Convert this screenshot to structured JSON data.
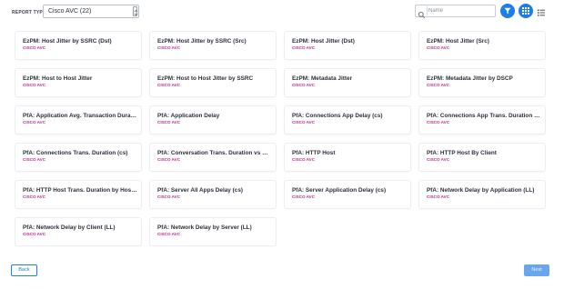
{
  "header": {
    "report_type_label": "REPORT TYPE:",
    "report_type_value": "Cisco AVC (22)",
    "search_placeholder": "Name"
  },
  "icons": {
    "filter_button": "filter-icon",
    "grid_view_button": "grid-view-icon",
    "list_view_button": "list-view-icon"
  },
  "colors": {
    "accent": "#1c7ee6",
    "subtitle": "#c2298b",
    "next_disabled": "#6aa6ee"
  },
  "cards": [
    {
      "title": "EzPM: Host Jitter by SSRC (Dst)",
      "subtitle": "CISCO AVC"
    },
    {
      "title": "EzPM: Host Jitter by SSRC (Src)",
      "subtitle": "CISCO AVC"
    },
    {
      "title": "EzPM: Host Jitter (Dst)",
      "subtitle": "CISCO AVC"
    },
    {
      "title": "EzPM: Host Jitter (Src)",
      "subtitle": "CISCO AVC"
    },
    {
      "title": "EzPM: Host to Host Jitter",
      "subtitle": "CISCO AVC"
    },
    {
      "title": "EzPM: Host to Host Jitter by SSRC",
      "subtitle": "CISCO AVC"
    },
    {
      "title": "EzPM: Metadata Jitter",
      "subtitle": "CISCO AVC"
    },
    {
      "title": "EzPM: Metadata Jitter by DSCP",
      "subtitle": "CISCO AVC"
    },
    {
      "title": "PfA: Application Avg. Transaction Duration",
      "subtitle": "CISCO AVC"
    },
    {
      "title": "PfA: Application Delay",
      "subtitle": "CISCO AVC"
    },
    {
      "title": "PfA: Connections App Delay (cs)",
      "subtitle": "CISCO AVC"
    },
    {
      "title": "PfA: Connections App Trans. Duration (cs)",
      "subtitle": "CISCO AVC"
    },
    {
      "title": "PfA: Connections Trans. Duration (cs)",
      "subtitle": "CISCO AVC"
    },
    {
      "title": "PfA: Conversation Trans. Duration vs Ret...",
      "subtitle": "CISCO AVC"
    },
    {
      "title": "PfA: HTTP Host",
      "subtitle": "CISCO AVC"
    },
    {
      "title": "PfA: HTTP Host By Client",
      "subtitle": "CISCO AVC"
    },
    {
      "title": "PfA: HTTP Host Trans. Duration by Host (...",
      "subtitle": "CISCO AVC"
    },
    {
      "title": "PfA: Server All Apps Delay (cs)",
      "subtitle": "CISCO AVC"
    },
    {
      "title": "PfA: Server Application Delay (cs)",
      "subtitle": "CISCO AVC"
    },
    {
      "title": "PfA: Network Delay by Application (LL)",
      "subtitle": "CISCO AVC"
    },
    {
      "title": "PfA: Network Delay by Client (LL)",
      "subtitle": "CISCO AVC"
    },
    {
      "title": "PfA: Network Delay by Server (LL)",
      "subtitle": "CISCO AVC"
    }
  ],
  "footer": {
    "back_label": "Back",
    "next_label": "Next"
  }
}
